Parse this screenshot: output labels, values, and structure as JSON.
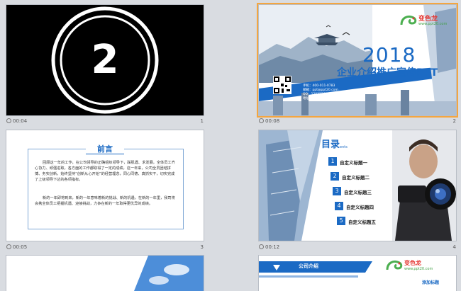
{
  "slides": [
    {
      "number": "1",
      "time": "00:04",
      "big_digit": "2"
    },
    {
      "number": "2",
      "time": "00:08",
      "year": "2018",
      "title": "企业介绍推广宣传PPT",
      "logo_text": "变色龙",
      "logo_url": "www.ppt20.com",
      "contacts": [
        "手机：400-011-0783",
        "邮箱：ppt@ppt20.com",
        "QQ：1203236104",
        "地址：..."
      ]
    },
    {
      "number": "3",
      "time": "00:05",
      "heading": "前言",
      "para1": "回顾这一年的工作，在公司领导的正确组织领导下，踩肌遇、求发展，全体员工齐心协力、顽强进取，各方面的工作都取得了一定的成绩，这一年来，公司全员团结拼搏、务实创新，始终坚持“创新从心开始”的经营理念，同心同德、真抓实干，切实完成了上级领导下达的各项指标。",
      "para2": "新的一年即将到来，新的一年意味着新的挑战、新的机遇，在新的一年里，我司将会携全体员工把握机遇、迎接挑战，力争在新的一年取得更优异的成绩。"
    },
    {
      "number": "4",
      "time": "00:12",
      "contents_title": "目录",
      "contents_sub": "ents",
      "items": [
        {
          "n": "1",
          "label": "自定义标题一"
        },
        {
          "n": "2",
          "label": "自定义标题二"
        },
        {
          "n": "3",
          "label": "自定义标题三"
        },
        {
          "n": "4",
          "label": "自定义标题四"
        },
        {
          "n": "5",
          "label": "自定义标题五"
        }
      ]
    },
    {
      "number": "5",
      "partial": true
    },
    {
      "number": "6",
      "partial": true,
      "section_title": "公司介绍",
      "sub_label": "添加标题",
      "logo_text": "变色龙",
      "logo_url": "www.ppt20.com"
    }
  ]
}
